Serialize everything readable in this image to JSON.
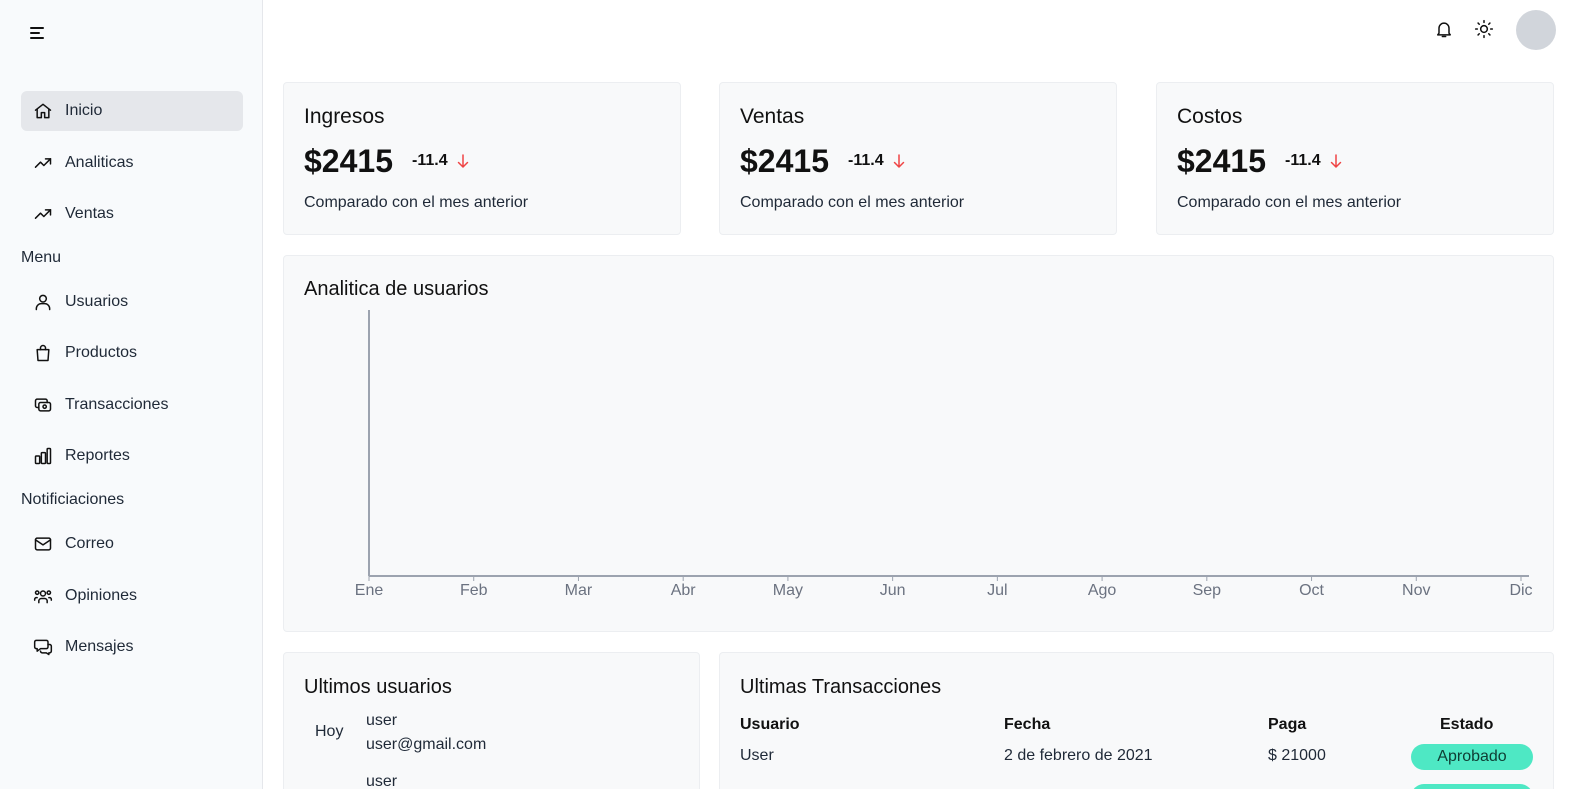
{
  "sidebar": {
    "items": [
      {
        "label": "Inicio",
        "icon": "home-icon"
      },
      {
        "label": "Analiticas",
        "icon": "trending-up-icon"
      },
      {
        "label": "Ventas",
        "icon": "trending-up-icon"
      },
      {
        "label": "Usuarios",
        "icon": "user-icon"
      },
      {
        "label": "Productos",
        "icon": "shopping-bag-icon"
      },
      {
        "label": "Transacciones",
        "icon": "cash-icon"
      },
      {
        "label": "Reportes",
        "icon": "bar-chart-icon"
      },
      {
        "label": "Correo",
        "icon": "mail-icon"
      },
      {
        "label": "Opiniones",
        "icon": "users-group-icon"
      },
      {
        "label": "Mensajes",
        "icon": "chat-icon"
      }
    ],
    "sections": {
      "menu": "Menu",
      "notifications": "Notificiaciones"
    }
  },
  "stats": [
    {
      "title": "Ingresos",
      "value": "$2415",
      "change": "-11.4",
      "subtitle": "Comparado con el mes anterior"
    },
    {
      "title": "Ventas",
      "value": "$2415",
      "change": "-11.4",
      "subtitle": "Comparado con el mes anterior"
    },
    {
      "title": "Costos",
      "value": "$2415",
      "change": "-11.4",
      "subtitle": "Comparado con el mes anterior"
    }
  ],
  "analytics": {
    "title": "Analitica de usuarios"
  },
  "chart_data": {
    "type": "line",
    "title": "Analitica de usuarios",
    "categories": [
      "Ene",
      "Feb",
      "Mar",
      "Abr",
      "May",
      "Jun",
      "Jul",
      "Ago",
      "Sep",
      "Oct",
      "Nov",
      "Dic"
    ],
    "series": [],
    "grid": false
  },
  "latest_users": {
    "title": "Ultimos usuarios",
    "rows": [
      {
        "when": "Hoy",
        "name": "user",
        "email": "user@gmail.com"
      },
      {
        "when": "",
        "name": "user",
        "email": ""
      }
    ]
  },
  "latest_transactions": {
    "title": "Ultimas Transacciones",
    "columns": [
      "Usuario",
      "Fecha",
      "Paga",
      "Estado"
    ],
    "rows": [
      {
        "user": "User",
        "date": "2 de febrero de 2021",
        "amount": "$ 21000",
        "status": "Aprobado"
      }
    ]
  },
  "colors": {
    "accent_badge": "#4ee8c4",
    "down_arrow": "#ef4444",
    "active_nav": "#e5e7eb"
  }
}
